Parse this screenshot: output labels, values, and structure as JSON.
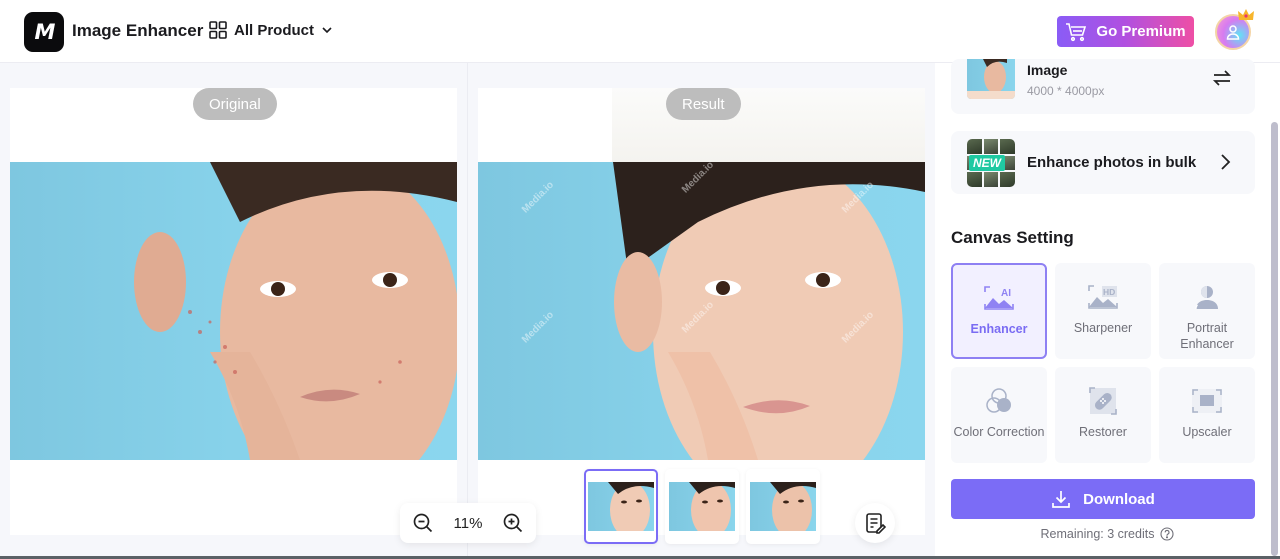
{
  "header": {
    "logo_text": "M",
    "app_title": "Image Enhancer",
    "all_product_label": "All Product",
    "premium_label": "Go Premium"
  },
  "canvas": {
    "original_label": "Original",
    "result_label": "Result",
    "watermark_text": "Media.io",
    "zoom_value": "11%",
    "thumbnails": [
      {
        "name": "variant-1",
        "selected": true
      },
      {
        "name": "variant-2",
        "selected": false
      },
      {
        "name": "variant-3",
        "selected": false
      }
    ]
  },
  "sidebar": {
    "image_card": {
      "title": "Image",
      "size": "4000 * 4000px"
    },
    "bulk_card": {
      "badge": "NEW",
      "label": "Enhance photos in bulk"
    },
    "section_title": "Canvas Setting",
    "tools": [
      {
        "label": "Enhancer",
        "icon": "ai-image-icon",
        "active": true
      },
      {
        "label": "Sharpener",
        "icon": "hd-image-icon",
        "active": false
      },
      {
        "label": "Portrait Enhancer",
        "icon": "portrait-icon",
        "active": false
      },
      {
        "label": "Color Correction",
        "icon": "color-circles-icon",
        "active": false
      },
      {
        "label": "Restorer",
        "icon": "bandage-icon",
        "active": false
      },
      {
        "label": "Upscaler",
        "icon": "upscale-icon",
        "active": false
      }
    ],
    "download_label": "Download",
    "credits_text": "Remaining: 3 credits"
  },
  "colors": {
    "accent": "#7b6cf6",
    "premium_gradient_start": "#8a5cf6",
    "premium_gradient_end": "#ee4fa5",
    "new_badge": "#1fc9a2",
    "photo_background": "#87d2ea"
  }
}
